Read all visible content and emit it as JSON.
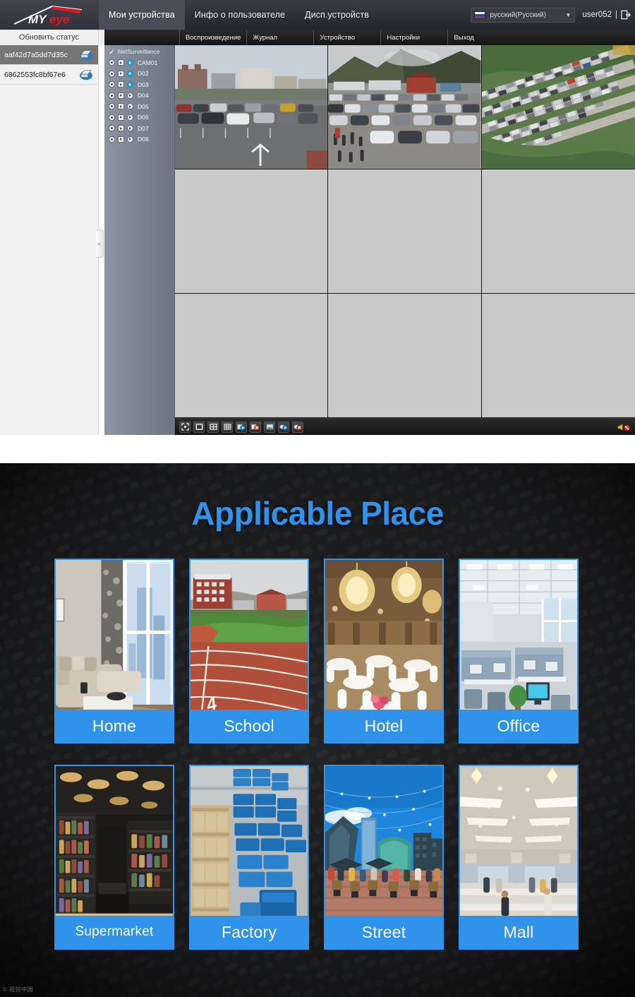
{
  "client": {
    "logo": {
      "text_my": "MY",
      "text_eye": "eye",
      "name": "myeye-logo"
    },
    "nav": [
      {
        "label": "Мои устройства",
        "active": true
      },
      {
        "label": "Инфо о пользователе",
        "active": false
      },
      {
        "label": "Дисп.устройств",
        "active": false
      }
    ],
    "language": {
      "value": "русский(Русский)",
      "flag": "russia-flag",
      "caret": "▼"
    },
    "user": {
      "name": "user052",
      "separator": "|",
      "logout_icon": "logout-icon"
    },
    "refresh_button": "Обновить статус",
    "subtabs": [
      {
        "label": "Воспроизведение"
      },
      {
        "label": "Журнал"
      },
      {
        "label": "Устройство"
      },
      {
        "label": "Настройки"
      },
      {
        "label": "Выход"
      }
    ],
    "devices": [
      {
        "id": "aaf42d7a5dd7d35c",
        "selected": true
      },
      {
        "id": "6862553fc8bf67e6",
        "selected": false
      }
    ],
    "collapse_handle": "«",
    "channel_tree": {
      "root": "NetSurveillance",
      "channels": [
        {
          "label": "CAM01",
          "active": true
        },
        {
          "label": "D02",
          "active": true
        },
        {
          "label": "D03",
          "active": true
        },
        {
          "label": "D04",
          "active": false
        },
        {
          "label": "D05",
          "active": false
        },
        {
          "label": "D06",
          "active": false
        },
        {
          "label": "D07",
          "active": false
        },
        {
          "label": "D08",
          "active": false
        }
      ]
    },
    "grid": {
      "rows": 3,
      "cols": 3,
      "cells": [
        {
          "state": "live",
          "scene": "parking-lot-street-level"
        },
        {
          "state": "live",
          "scene": "parking-lot-mountain-valley"
        },
        {
          "state": "live",
          "scene": "parking-lot-aerial"
        },
        {
          "state": "empty",
          "scene": ""
        },
        {
          "state": "empty",
          "scene": ""
        },
        {
          "state": "empty",
          "scene": ""
        },
        {
          "state": "empty",
          "scene": ""
        },
        {
          "state": "empty",
          "scene": ""
        },
        {
          "state": "empty",
          "scene": ""
        }
      ]
    },
    "player_toolbar": [
      {
        "icon": "fullscreen-icon"
      },
      {
        "icon": "single-view-icon"
      },
      {
        "icon": "four-split-view-icon"
      },
      {
        "icon": "nine-split-view-icon"
      },
      {
        "icon": "open-all-preview-icon"
      },
      {
        "icon": "close-all-preview-icon"
      },
      {
        "icon": "snapshot-icon"
      },
      {
        "icon": "start-record-icon"
      },
      {
        "icon": "stop-record-icon"
      }
    ],
    "mute_icon": "mute-speaker-icon"
  },
  "places": {
    "title": "Applicable Place",
    "accent_color": "#2f93ec",
    "background_color": "#1e1f21",
    "watermark": "© 视觉中国",
    "cards": [
      {
        "label": "Home",
        "scene": "living-room-sofa-window"
      },
      {
        "label": "School",
        "scene": "running-track-campus"
      },
      {
        "label": "Hotel",
        "scene": "banquet-hall-chandeliers"
      },
      {
        "label": "Office",
        "scene": "open-plan-office-desks"
      },
      {
        "label": "Supermarket",
        "scene": "retail-store-aisle"
      },
      {
        "label": "Factory",
        "scene": "warehouse-blue-crates"
      },
      {
        "label": "Street",
        "scene": "city-plaza-crowd"
      },
      {
        "label": "Mall",
        "scene": "shopping-mall-interior"
      }
    ]
  }
}
